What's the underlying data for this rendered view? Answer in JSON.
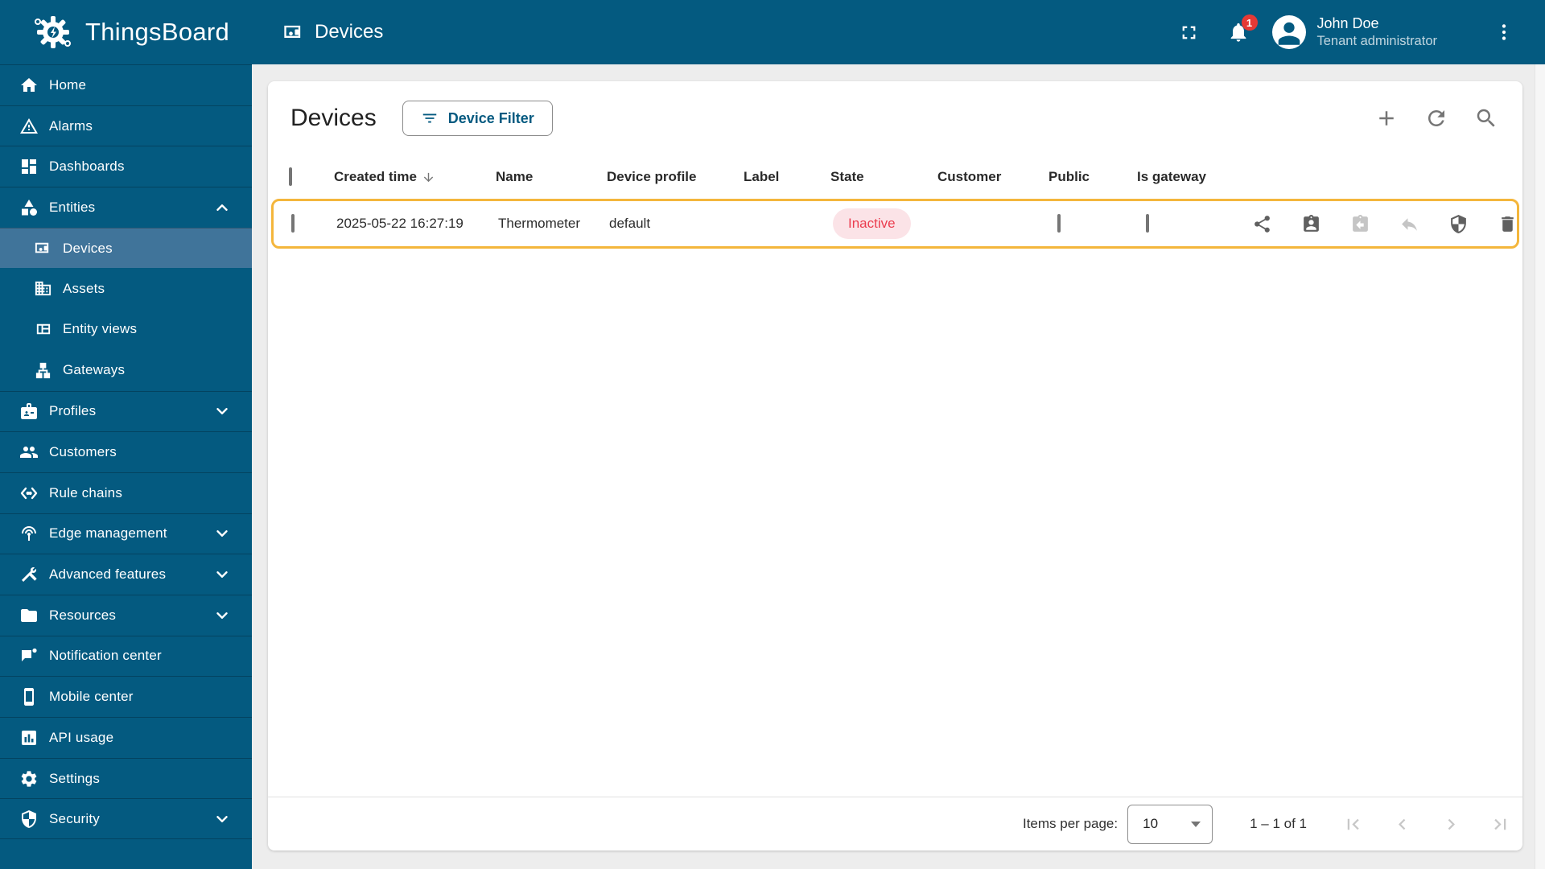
{
  "app": {
    "name": "ThingsBoard"
  },
  "topbar": {
    "breadcrumb": "Devices",
    "notification_count": "1",
    "user": {
      "name": "John Doe",
      "role": "Tenant administrator"
    },
    "icons": [
      "fullscreen-icon",
      "bell-icon",
      "avatar-person-icon",
      "kebab-menu-icon"
    ]
  },
  "sidebar": {
    "items": [
      {
        "label": "Home",
        "icon": "home-icon"
      },
      {
        "label": "Alarms",
        "icon": "warning-icon"
      },
      {
        "label": "Dashboards",
        "icon": "dashboard-icon"
      },
      {
        "label": "Entities",
        "icon": "category-icon",
        "chevron": "up"
      },
      {
        "label": "Devices",
        "icon": "devices-icon",
        "selected": true,
        "sub": true
      },
      {
        "label": "Assets",
        "icon": "building-icon",
        "sub": true
      },
      {
        "label": "Entity views",
        "icon": "view-grid-icon",
        "sub": true
      },
      {
        "label": "Gateways",
        "icon": "lan-icon",
        "sub": true
      },
      {
        "label": "Profiles",
        "icon": "badge-icon",
        "chevron": "down"
      },
      {
        "label": "Customers",
        "icon": "people-icon"
      },
      {
        "label": "Rule chains",
        "icon": "rule-chain-icon"
      },
      {
        "label": "Edge management",
        "icon": "antenna-icon",
        "chevron": "down"
      },
      {
        "label": "Advanced features",
        "icon": "tools-icon",
        "chevron": "down"
      },
      {
        "label": "Resources",
        "icon": "folder-icon",
        "chevron": "down"
      },
      {
        "label": "Notification center",
        "icon": "notification-icon"
      },
      {
        "label": "Mobile center",
        "icon": "phone-icon"
      },
      {
        "label": "API usage",
        "icon": "chart-icon"
      },
      {
        "label": "Settings",
        "icon": "gear-icon"
      },
      {
        "label": "Security",
        "icon": "shield-icon",
        "chevron": "down"
      }
    ]
  },
  "page": {
    "title": "Devices",
    "filter_button_label": "Device Filter",
    "toolbar_icons": [
      "add-icon",
      "refresh-icon",
      "search-icon"
    ],
    "table": {
      "columns": [
        "Created time",
        "Name",
        "Device profile",
        "Label",
        "State",
        "Customer",
        "Public",
        "Is gateway"
      ],
      "sorted_by": "Created time",
      "sort_direction": "desc",
      "rows": [
        {
          "created_time": "2025-05-22 16:27:19",
          "name": "Thermometer",
          "device_profile": "default",
          "label": "",
          "state": "Inactive",
          "customer": "",
          "public": false,
          "is_gateway": false,
          "row_actions": [
            "share-icon",
            "assign-customer-icon",
            "manage-credentials-icon",
            "unassign-icon",
            "shield-icon",
            "delete-icon"
          ]
        }
      ]
    },
    "pagination": {
      "items_per_page_label": "Items per page:",
      "items_per_page": "10",
      "range": "1 – 1 of 1",
      "pager_icons": [
        "first-page-icon",
        "previous-page-icon",
        "next-page-icon",
        "last-page-icon"
      ]
    }
  },
  "colors": {
    "primary": "#045A80",
    "sidebar_selected": "#40749A",
    "row_highlight_border": "#F4B63C",
    "inactive_text": "#EB3D4F",
    "inactive_bg": "#FBE3E7",
    "notification_badge": "#E53935",
    "icon_gray": "#757575",
    "icon_disabled": "#C5C5C5",
    "background": "#EDEDED"
  }
}
